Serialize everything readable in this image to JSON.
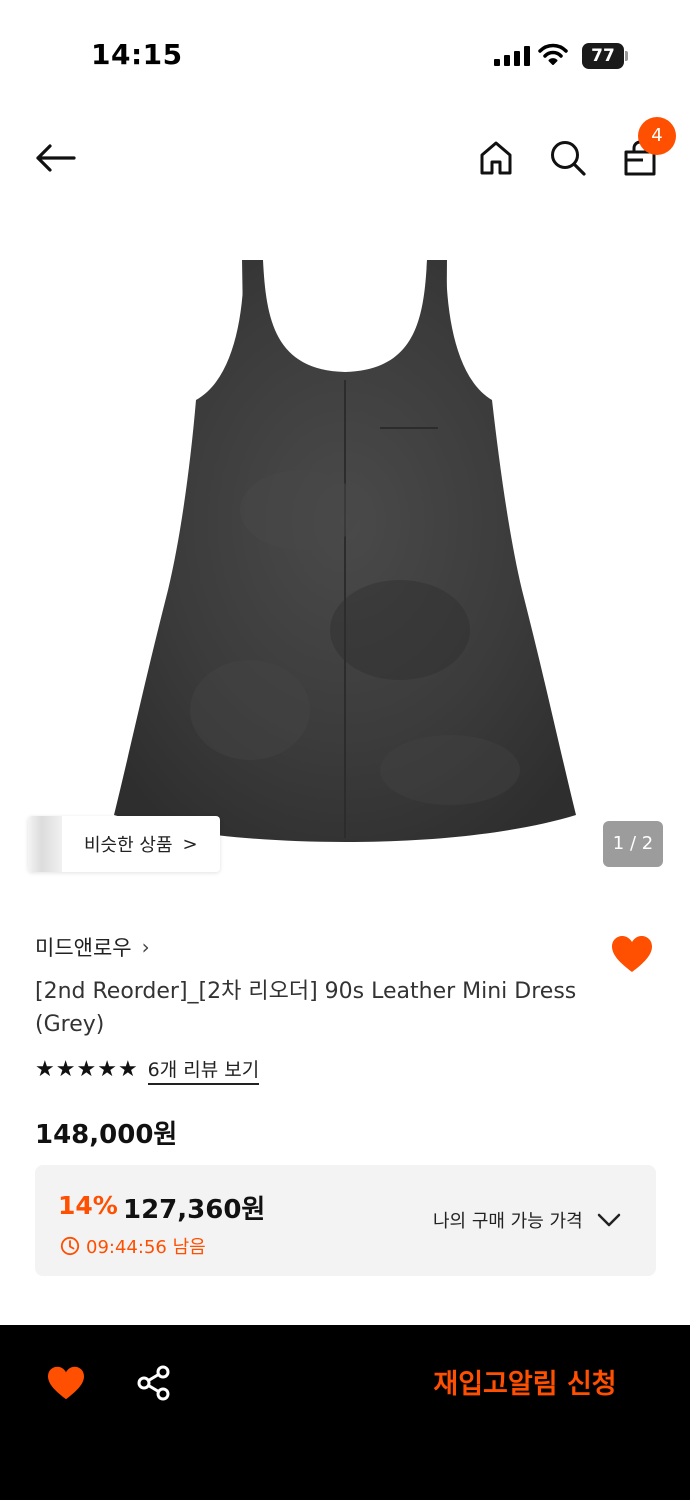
{
  "status_bar": {
    "time": "14:15",
    "battery": "77"
  },
  "nav": {
    "cart_count": "4"
  },
  "gallery": {
    "similar_label": "비슷한 상품",
    "similar_chevron": ">",
    "page_indicator": "1 / 2"
  },
  "product": {
    "brand": "미드앤로우",
    "brand_chevron": "›",
    "title": "[2nd Reorder]_[2차 리오더] 90s Leather Mini Dress (Grey)",
    "rating_stars": 5,
    "review_link": "6개 리뷰 보기",
    "original_price": "148,000원",
    "wishlisted": true
  },
  "discount": {
    "rate": "14%",
    "price": "127,360원",
    "timer": "09:44:56 남음",
    "my_price_label": "나의 구매 가능 가격"
  },
  "bottom_bar": {
    "restock_label": "재입고알림 신청"
  },
  "colors": {
    "accent": "#ff4f00",
    "bottom_bar_bg": "#000000",
    "discount_box_bg": "#f3f3f3"
  },
  "icons": {
    "back": "arrow-left-icon",
    "home": "home-icon",
    "search": "search-icon",
    "cart": "shopping-bag-icon",
    "wish": "heart-icon",
    "share": "share-icon",
    "timer": "clock-icon",
    "dropdown": "chevron-down-icon"
  }
}
